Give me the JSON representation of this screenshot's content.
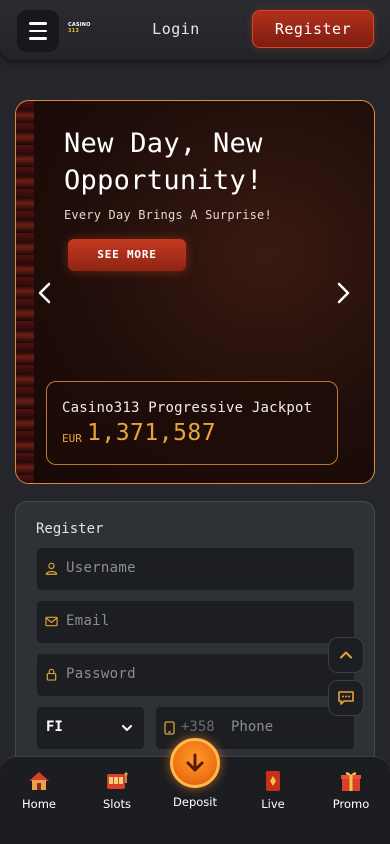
{
  "header": {
    "logo_line1": "CASINO",
    "logo_line2": "313",
    "login_label": "Login",
    "register_label": "Register"
  },
  "banner": {
    "title": "New Day, New Opportunity!",
    "subtitle": "Every Day Brings A Surprise!",
    "cta_label": "SEE MORE",
    "jackpot_label": "Casino313 Progressive Jackpot",
    "jackpot_currency": "EUR",
    "jackpot_amount": "1,371,587"
  },
  "form": {
    "title": "Register",
    "username_placeholder": "Username",
    "email_placeholder": "Email",
    "password_placeholder": "Password",
    "country_value": "FI",
    "phone_code": "+358",
    "phone_placeholder": "Phone"
  },
  "nav": {
    "home": "Home",
    "slots": "Slots",
    "deposit": "Deposit",
    "live": "Live",
    "promo": "Promo"
  },
  "colors": {
    "accent_red": "#b2301c",
    "accent_orange": "#f07414",
    "jackpot_gold": "#e7a63a",
    "banner_border": "#e2893a"
  },
  "icons": [
    "menu-icon",
    "chevron-left-icon",
    "chevron-right-icon",
    "user-icon",
    "mail-icon",
    "lock-icon",
    "chevron-down-icon",
    "phone-icon",
    "chevron-up-icon",
    "chat-icon",
    "home-icon",
    "slots-icon",
    "deposit-icon",
    "live-icon",
    "promo-icon"
  ]
}
